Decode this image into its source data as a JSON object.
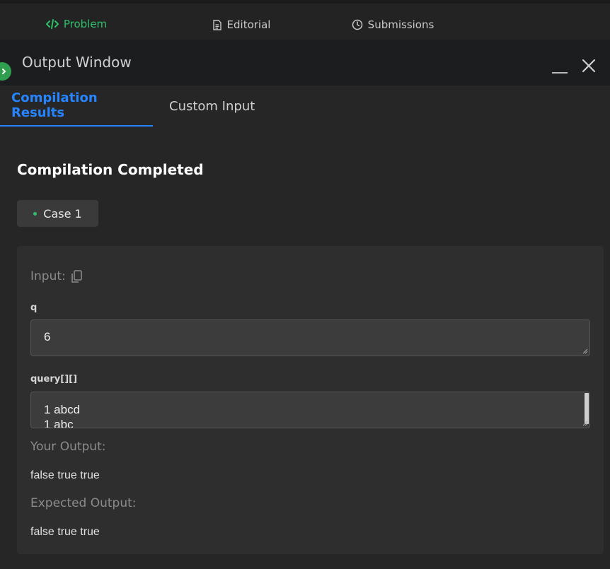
{
  "top_tabs": [
    {
      "label": "Problem",
      "icon": "code-icon",
      "active": true
    },
    {
      "label": "Editorial",
      "icon": "document-icon",
      "active": false
    },
    {
      "label": "Submissions",
      "icon": "clock-icon",
      "active": false
    }
  ],
  "output_window": {
    "title": "Output Window"
  },
  "sub_tabs": [
    {
      "label": "Compilation Results",
      "active": true
    },
    {
      "label": "Custom Input",
      "active": false
    }
  ],
  "status_heading": "Compilation Completed",
  "case_button": {
    "label": "Case 1"
  },
  "panel": {
    "input_label": "Input:",
    "variables": [
      {
        "name": "q",
        "value": "6"
      },
      {
        "name": "query[][]",
        "value_lines": [
          "1 abcd",
          "1 abc"
        ]
      }
    ],
    "your_output_label": "Your Output:",
    "your_output": "false true true",
    "expected_output_label": "Expected Output:",
    "expected_output": "false true true"
  },
  "colors": {
    "accent_green": "#2fbf6a",
    "accent_blue": "#2684ff",
    "background": "#262626"
  }
}
